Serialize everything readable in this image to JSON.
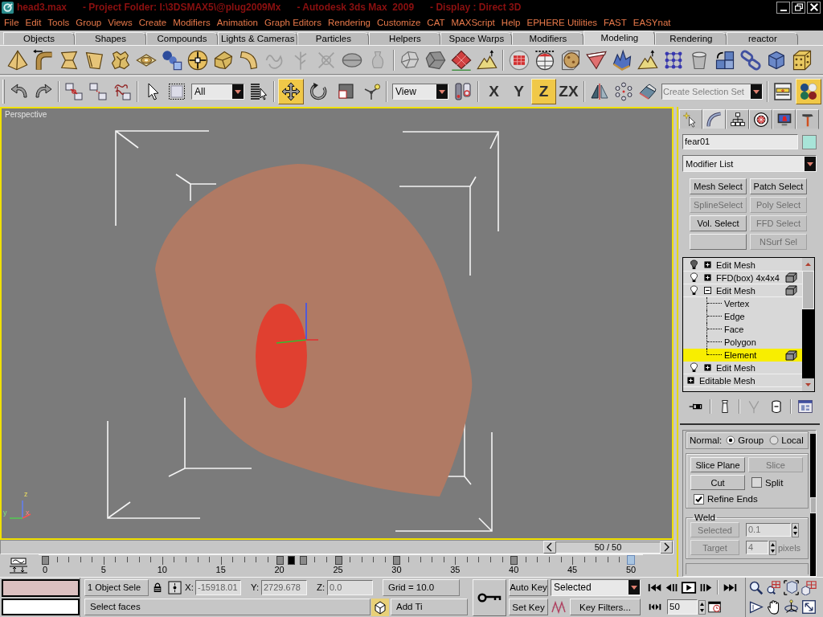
{
  "window": {
    "title": "head3.max      - Project Folder: I:\\3DSMAX5\\@plug2009Mx      - Autodesk 3ds Max  2009      - Display : Direct 3D"
  },
  "menu": [
    "File",
    "Edit",
    "Tools",
    "Group",
    "Views",
    "Create",
    "Modifiers",
    "Animation",
    "Graph Editors",
    "Rendering",
    "Customize",
    "CAT",
    "MAXScript",
    "Help",
    "EPHERE Utilities",
    "FAST",
    "EASYnat"
  ],
  "command_tabs": [
    {
      "label": "Objects",
      "selected": false
    },
    {
      "label": "Shapes",
      "selected": false
    },
    {
      "label": "Compounds",
      "selected": false
    },
    {
      "label": "Lights & Cameras",
      "selected": false
    },
    {
      "label": "Particles",
      "selected": false
    },
    {
      "label": "Helpers",
      "selected": false
    },
    {
      "label": "Space Warps",
      "selected": false
    },
    {
      "label": "Modifiers",
      "selected": false
    },
    {
      "label": "Modeling",
      "selected": true
    },
    {
      "label": "Rendering",
      "selected": false
    },
    {
      "label": "reactor",
      "selected": false
    }
  ],
  "modeling_tools": [
    {
      "disabled": false
    },
    {
      "disabled": false
    },
    {
      "disabled": false
    },
    {
      "disabled": false
    },
    {
      "disabled": false
    },
    {
      "disabled": false
    },
    {
      "disabled": false
    },
    {
      "disabled": false
    },
    {
      "disabled": false
    },
    {
      "disabled": false
    },
    {
      "disabled": true
    },
    {
      "disabled": true
    },
    {
      "disabled": true
    },
    {
      "disabled": false
    },
    {
      "disabled": true
    },
    {
      "disabled": false
    },
    {
      "disabled": false
    },
    {
      "disabled": false
    },
    {
      "disabled": false
    },
    {
      "disabled": false
    },
    {
      "disabled": false
    },
    {
      "disabled": false
    },
    {
      "disabled": false
    },
    {
      "disabled": false
    },
    {
      "disabled": false
    },
    {
      "disabled": false
    },
    {
      "disabled": false
    },
    {
      "disabled": false
    },
    {
      "disabled": false
    },
    {
      "disabled": false
    },
    {
      "disabled": false
    }
  ],
  "main_toolbar": {
    "selection_filter": "All",
    "transform_tools": [
      {
        "selected": true
      },
      {
        "selected": false
      },
      {
        "selected": false
      }
    ],
    "coordinate_system": "View",
    "axis_constraints": [
      {
        "label": "X",
        "selected": false
      },
      {
        "label": "Y",
        "selected": false
      },
      {
        "label": "Z",
        "selected": true
      },
      {
        "label": "ZX",
        "selected": false
      }
    ],
    "selection_set": {
      "placeholder": "Create Selection Set"
    },
    "material_editor": {
      "selected": true
    }
  },
  "viewport": {
    "label": "Perspective",
    "active": true,
    "axis_labels": [
      "z",
      "y",
      "x"
    ]
  },
  "time_slider": {
    "reading": "50 / 50",
    "level": 1
  },
  "track_bar": {
    "labels": [
      "0",
      "5",
      "10",
      "15",
      "20",
      "25",
      "30",
      "35",
      "40",
      "45",
      "50"
    ],
    "frames": [
      {
        "key": true,
        "selected": false
      },
      {
        "key": false,
        "selected": false
      },
      {
        "key": false,
        "selected": false
      },
      {
        "key": false,
        "selected": false
      },
      {
        "key": false,
        "selected": false
      },
      {
        "key": false,
        "selected": false
      },
      {
        "key": false,
        "selected": false
      },
      {
        "key": false,
        "selected": false
      },
      {
        "key": false,
        "selected": false
      },
      {
        "key": false,
        "selected": false
      },
      {
        "key": false,
        "selected": false
      },
      {
        "key": false,
        "selected": false
      },
      {
        "key": false,
        "selected": false
      },
      {
        "key": false,
        "selected": false
      },
      {
        "key": false,
        "selected": false
      },
      {
        "key": false,
        "selected": false
      },
      {
        "key": false,
        "selected": false
      },
      {
        "key": false,
        "selected": false
      },
      {
        "key": false,
        "selected": false
      },
      {
        "key": false,
        "selected": false
      },
      {
        "key": true,
        "selected": false
      },
      {
        "key": true,
        "selected": true
      },
      {
        "key": true,
        "selected": false
      },
      {
        "key": false,
        "selected": false
      },
      {
        "key": false,
        "selected": false
      },
      {
        "key": true,
        "selected": false
      },
      {
        "key": false,
        "selected": false
      },
      {
        "key": false,
        "selected": false
      },
      {
        "key": false,
        "selected": false
      },
      {
        "key": false,
        "selected": false
      },
      {
        "key": true,
        "selected": false
      },
      {
        "key": false,
        "selected": false
      },
      {
        "key": false,
        "selected": false
      },
      {
        "key": false,
        "selected": false
      },
      {
        "key": false,
        "selected": false
      },
      {
        "key": false,
        "selected": false
      },
      {
        "key": false,
        "selected": false
      },
      {
        "key": false,
        "selected": false
      },
      {
        "key": false,
        "selected": false
      },
      {
        "key": false,
        "selected": false
      },
      {
        "key": true,
        "selected": false
      },
      {
        "key": false,
        "selected": false
      },
      {
        "key": false,
        "selected": false
      },
      {
        "key": false,
        "selected": false
      },
      {
        "key": false,
        "selected": false
      },
      {
        "key": false,
        "selected": false
      },
      {
        "key": false,
        "selected": false
      },
      {
        "key": false,
        "selected": false
      },
      {
        "key": false,
        "selected": false
      },
      {
        "key": false,
        "selected": false
      },
      {
        "key": false,
        "selected": false
      }
    ]
  },
  "command_panel": {
    "tabs": [
      {
        "selected": false
      },
      {
        "selected": true
      },
      {
        "selected": false
      },
      {
        "selected": false
      },
      {
        "selected": false
      },
      {
        "selected": false
      }
    ],
    "object_name": "fear01",
    "modifier_list": "Modifier List",
    "modifier_buttons": [
      {
        "label": "Mesh Select",
        "disabled": false
      },
      {
        "label": "Patch Select",
        "disabled": false
      },
      {
        "label": "SplineSelect",
        "disabled": true
      },
      {
        "label": "Poly Select",
        "disabled": true
      },
      {
        "label": "Vol. Select",
        "disabled": false
      },
      {
        "label": "FFD Select",
        "disabled": true
      },
      {
        "disabled": false
      },
      {
        "label": "NSurf Sel",
        "disabled": true
      }
    ],
    "stack": [
      {
        "kind": "modifier",
        "label": "Edit Mesh",
        "on": false,
        "expanded": false,
        "cube_icon": false,
        "selected": false
      },
      {
        "kind": "modifier",
        "label": "FFD(box) 4x4x4",
        "on": true,
        "expanded": false,
        "cube_icon": true,
        "selected": false
      },
      {
        "kind": "modifier",
        "label": "Edit Mesh",
        "on": true,
        "expanded": true,
        "cube_icon": true,
        "selected": false,
        "children": [
          {
            "label": "Vertex",
            "cube_icon": false,
            "selected": false
          },
          {
            "label": "Edge",
            "cube_icon": false,
            "selected": false
          },
          {
            "label": "Face",
            "cube_icon": false,
            "selected": false
          },
          {
            "label": "Polygon",
            "cube_icon": false,
            "selected": false
          },
          {
            "label": "Element",
            "cube_icon": true,
            "selected": true
          }
        ]
      },
      {
        "kind": "modifier",
        "label": "Edit Mesh",
        "on": true,
        "expanded": false,
        "cube_icon": false,
        "selected": false
      },
      {
        "kind": "base",
        "label": "Editable Mesh",
        "expanded": false,
        "cube_icon": false,
        "selected": false
      }
    ],
    "stack_tools": [
      {
        "disabled": false
      },
      {
        "disabled": false
      },
      {
        "disabled": true
      },
      {
        "disabled": false
      },
      {
        "disabled": false
      }
    ],
    "rollout": {
      "normal": {
        "label": "Normal:",
        "options": [
          {
            "label": "Group",
            "selected": true
          },
          {
            "label": "Local",
            "selected": false
          }
        ]
      },
      "slice_plane": {
        "label": "Slice Plane",
        "disabled": false
      },
      "slice": {
        "label": "Slice",
        "disabled": true
      },
      "cut": {
        "label": "Cut",
        "disabled": false
      },
      "split": {
        "label": "Split",
        "checked": false
      },
      "refine_ends": {
        "label": "Refine Ends",
        "checked": true
      },
      "weld": {
        "title": "Weld",
        "selected_button": {
          "label": "Selected",
          "disabled": true
        },
        "threshold": {
          "value": "0.1",
          "disabled": true
        },
        "target_button": {
          "label": "Target",
          "disabled": true
        },
        "target_pixels": {
          "value": "4",
          "disabled": true
        },
        "unit": "pixels"
      }
    }
  },
  "status_bar": {
    "selection": "1 Object Sele",
    "coordinates": [
      {
        "label": "X:",
        "value": "-15918.01"
      },
      {
        "label": "Y:",
        "value": "2729.678"
      },
      {
        "label": "Z:",
        "value": "0.0"
      }
    ],
    "grid": "Grid = 10.0",
    "prompt": "Select faces",
    "time_tag": "Add Ti"
  },
  "animation": {
    "auto_key": "Auto Key",
    "set_key": "Set Key",
    "key_mode": "Selected",
    "key_filters": "Key Filters...",
    "current_frame": "50"
  }
}
